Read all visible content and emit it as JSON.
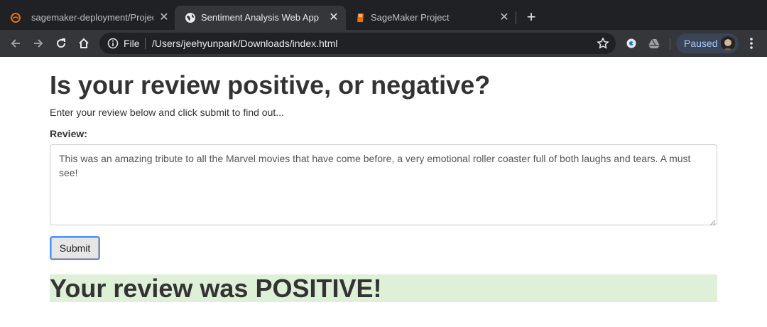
{
  "browser": {
    "tabs": [
      {
        "title": "sagemaker-deployment/Projec",
        "favicon": "github-icon",
        "active": false
      },
      {
        "title": "Sentiment Analysis Web App",
        "favicon": "globe-icon",
        "active": true
      },
      {
        "title": "SageMaker Project",
        "favicon": "book-icon",
        "active": false
      }
    ],
    "new_tab": "+",
    "close_glyph": "✕",
    "address": {
      "scheme_label": "File",
      "url": "/Users/jeehyunpark/Downloads/index.html"
    },
    "profile": {
      "label": "Paused"
    },
    "colors": {
      "tabstrip": "#202124",
      "toolbar": "#35363a",
      "omnibox": "#202124",
      "profile_chip": "#394457",
      "accent_orange": "#e8710a"
    }
  },
  "page": {
    "heading": "Is your review positive, or negative?",
    "intro": "Enter your review below and click submit to find out...",
    "review_label": "Review:",
    "review_text": "This was an amazing tribute to all the Marvel movies that have come before, a very emotional roller coaster full of both laughs and tears. A must see!",
    "submit_label": "Submit",
    "result": "Your review was POSITIVE!",
    "colors": {
      "result_bg": "#dff0d8",
      "text": "#333333",
      "focus_ring": "#4d90fe"
    }
  }
}
